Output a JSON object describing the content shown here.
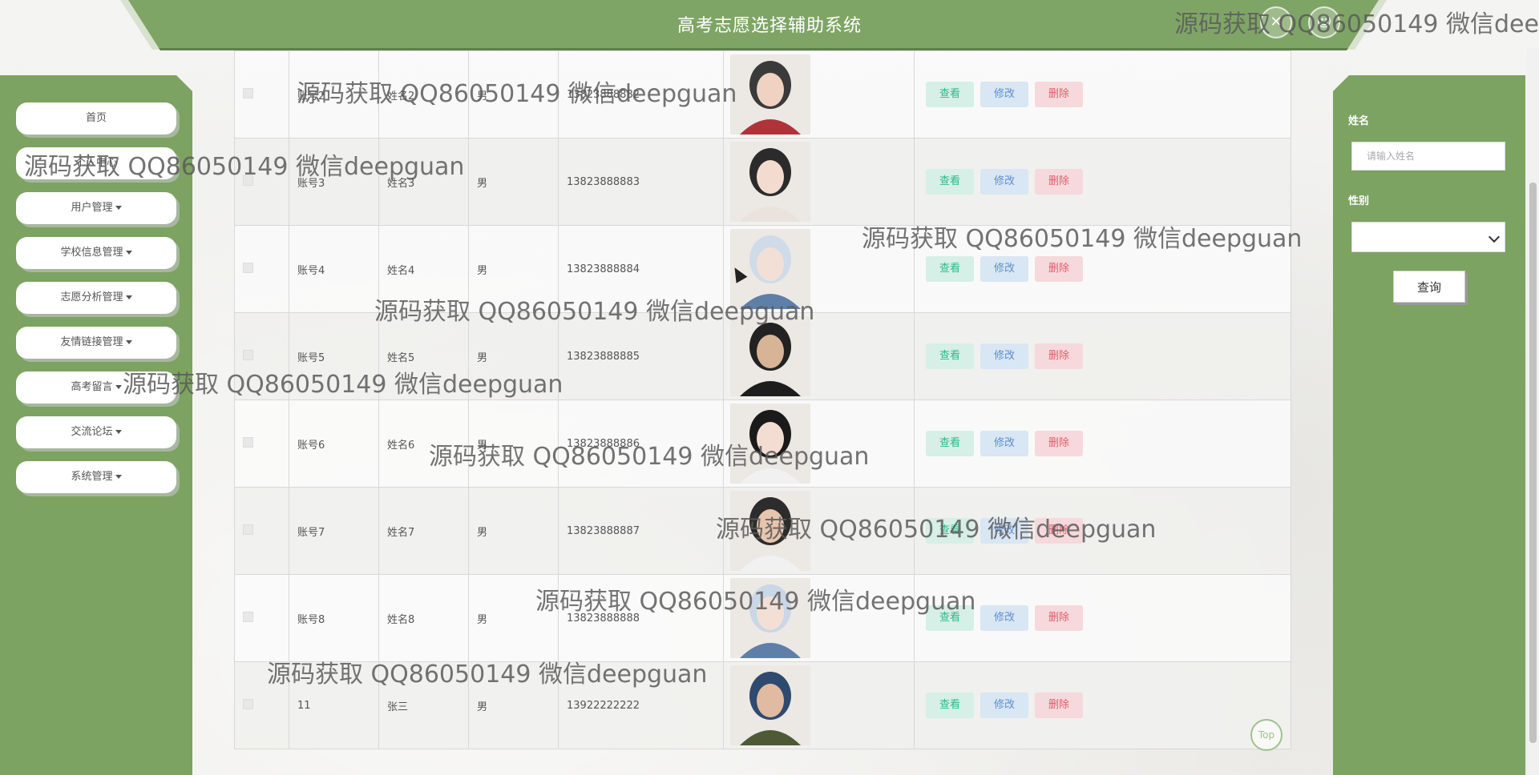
{
  "header": {
    "title": "高考志愿选择辅助系统",
    "icons": [
      "close-icon",
      "user-icon"
    ]
  },
  "sidebar": {
    "items": [
      {
        "label": "首页",
        "dropdown": false
      },
      {
        "label": "个人中心",
        "dropdown": false
      },
      {
        "label": "用户管理",
        "dropdown": true
      },
      {
        "label": "学校信息管理",
        "dropdown": true
      },
      {
        "label": "志愿分析管理",
        "dropdown": true
      },
      {
        "label": "友情链接管理",
        "dropdown": true
      },
      {
        "label": "高考留言",
        "dropdown": true
      },
      {
        "label": "交流论坛",
        "dropdown": true
      },
      {
        "label": "系统管理",
        "dropdown": true
      }
    ]
  },
  "search": {
    "name_label": "姓名",
    "name_placeholder": "请输入姓名",
    "gender_label": "性别",
    "gender_value": "",
    "query_button": "查询"
  },
  "table": {
    "rows": [
      {
        "account": "账号2",
        "name": "姓名2",
        "gender": "男",
        "phone": "13823888882",
        "photo": "photo-red-dress"
      },
      {
        "account": "账号3",
        "name": "姓名3",
        "gender": "男",
        "phone": "13823888883",
        "photo": "photo-salute"
      },
      {
        "account": "账号4",
        "name": "姓名4",
        "gender": "男",
        "phone": "13823888884",
        "photo": "photo-goggles"
      },
      {
        "account": "账号5",
        "name": "姓名5",
        "gender": "男",
        "phone": "13823888885",
        "photo": "photo-tanktop"
      },
      {
        "account": "账号6",
        "name": "姓名6",
        "gender": "男",
        "phone": "13823888886",
        "photo": "photo-bangs"
      },
      {
        "account": "账号7",
        "name": "姓名7",
        "gender": "男",
        "phone": "13823888887",
        "photo": "photo-white-shirt"
      },
      {
        "account": "账号8",
        "name": "姓名8",
        "gender": "男",
        "phone": "13823888888",
        "photo": "photo-goggles-2"
      },
      {
        "account": "11",
        "name": "张三",
        "gender": "男",
        "phone": "13922222222",
        "photo": "photo-soldier"
      }
    ],
    "actions": {
      "view": "查看",
      "edit": "修改",
      "delete": "删除"
    }
  },
  "back_to_top": "Top",
  "watermark": "源码获取 QQ86050149 微信deepguan",
  "colors": {
    "theme_green": "#7ca361",
    "header_green": "#7fa566",
    "view_text": "#2bbb8a",
    "edit_text": "#5b8fd0",
    "delete_text": "#dd5e6a"
  }
}
